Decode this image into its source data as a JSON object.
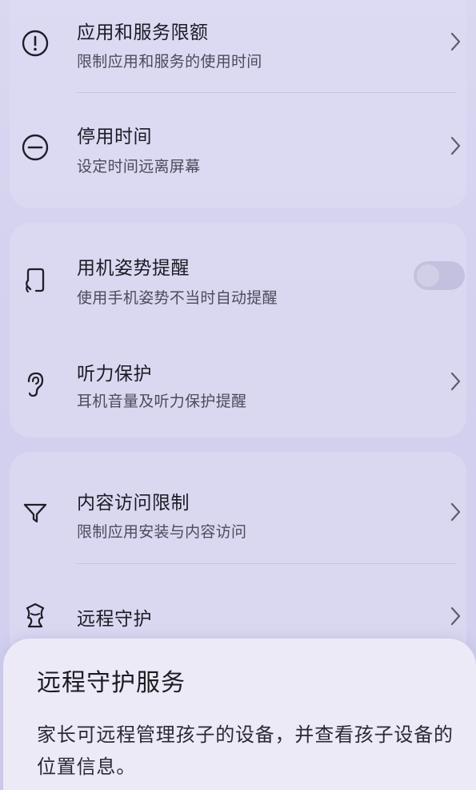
{
  "settings_list": {
    "items": [
      {
        "title": "应用和服务限额",
        "subtitle": "限制应用和服务的使用时间",
        "icon": "alert-circle-icon",
        "control": "chevron"
      },
      {
        "title": "停用时间",
        "subtitle": "设定时间远离屏幕",
        "icon": "minus-circle-icon",
        "control": "chevron"
      },
      {
        "title": "用机姿势提醒",
        "subtitle": "使用手机姿势不当时自动提醒",
        "icon": "phone-posture-icon",
        "control": "toggle",
        "toggle_on": false
      },
      {
        "title": "听力保护",
        "subtitle": "耳机音量及听力保护提醒",
        "icon": "ear-icon",
        "control": "chevron"
      },
      {
        "title": "内容访问限制",
        "subtitle": "限制应用安装与内容访问",
        "icon": "filter-icon",
        "control": "chevron"
      },
      {
        "title": "远程守护",
        "icon": "remote-guard-icon",
        "control": "chevron"
      }
    ]
  },
  "bottom_sheet": {
    "title": "远程守护服务",
    "body": "家长可远程管理孩子的设备，并查看孩子设备的位置信息。"
  },
  "colors": {
    "background": "#d6d4ef",
    "card": "#e0def4",
    "sheet": "#ebeaf6",
    "text_primary": "#1b1b24",
    "text_secondary": "#4c4b5a"
  }
}
